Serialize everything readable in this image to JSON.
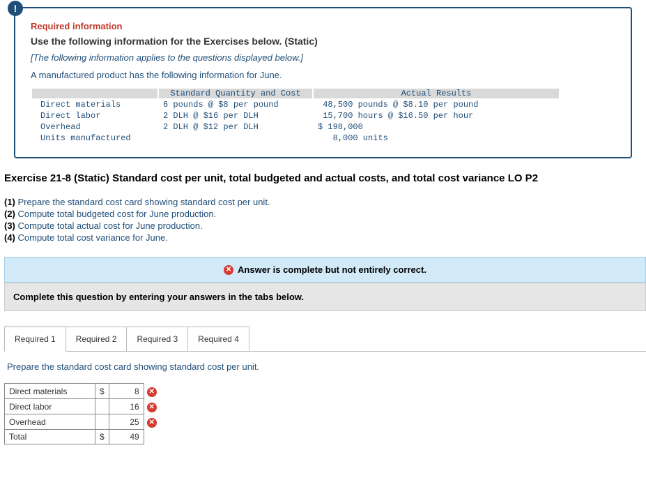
{
  "info": {
    "required_label": "Required information",
    "bold_line": "Use the following information for the Exercises below. (Static)",
    "italic_line": "[The following information applies to the questions displayed below.]",
    "intro_line": "A manufactured product has the following information for June.",
    "table_header_std": "Standard Quantity and Cost",
    "table_header_act": "Actual Results",
    "rows": [
      {
        "label": "Direct materials",
        "std": "6 pounds @ $8 per pound",
        "act": " 48,500 pounds @ $8.10 per pound"
      },
      {
        "label": "Direct labor",
        "std": "2 DLH @ $16 per DLH",
        "act": " 15,700 hours @ $16.50 per hour"
      },
      {
        "label": "Overhead",
        "std": "2 DLH @ $12 per DLH",
        "act": "$ 198,000"
      },
      {
        "label": "Units manufactured",
        "std": "",
        "act": "   8,000 units"
      }
    ]
  },
  "exercise_title": "Exercise 21-8 (Static) Standard cost per unit, total budgeted and actual costs, and total cost variance LO P2",
  "tasks": [
    {
      "num": "(1)",
      "text": " Prepare the standard cost card showing standard cost per unit."
    },
    {
      "num": "(2)",
      "text": " Compute total budgeted cost for June production."
    },
    {
      "num": "(3)",
      "text": " Compute total actual cost for June production."
    },
    {
      "num": "(4)",
      "text": " Compute total cost variance for June."
    }
  ],
  "status_text": "Answer is complete but not entirely correct.",
  "complete_instruction": "Complete this question by entering your answers in the tabs below.",
  "tabs": [
    {
      "label": "Required 1",
      "active": true
    },
    {
      "label": "Required 2",
      "active": false
    },
    {
      "label": "Required 3",
      "active": false
    },
    {
      "label": "Required 4",
      "active": false
    }
  ],
  "tab_instruction": "Prepare the standard cost card showing standard cost per unit.",
  "answer_rows": [
    {
      "label": "Direct materials",
      "currency": "$",
      "value": "8",
      "wrong": true
    },
    {
      "label": "Direct labor",
      "currency": "",
      "value": "16",
      "wrong": true
    },
    {
      "label": "Overhead",
      "currency": "",
      "value": "25",
      "wrong": true
    },
    {
      "label": "Total",
      "currency": "$",
      "value": "49",
      "wrong": false
    }
  ]
}
